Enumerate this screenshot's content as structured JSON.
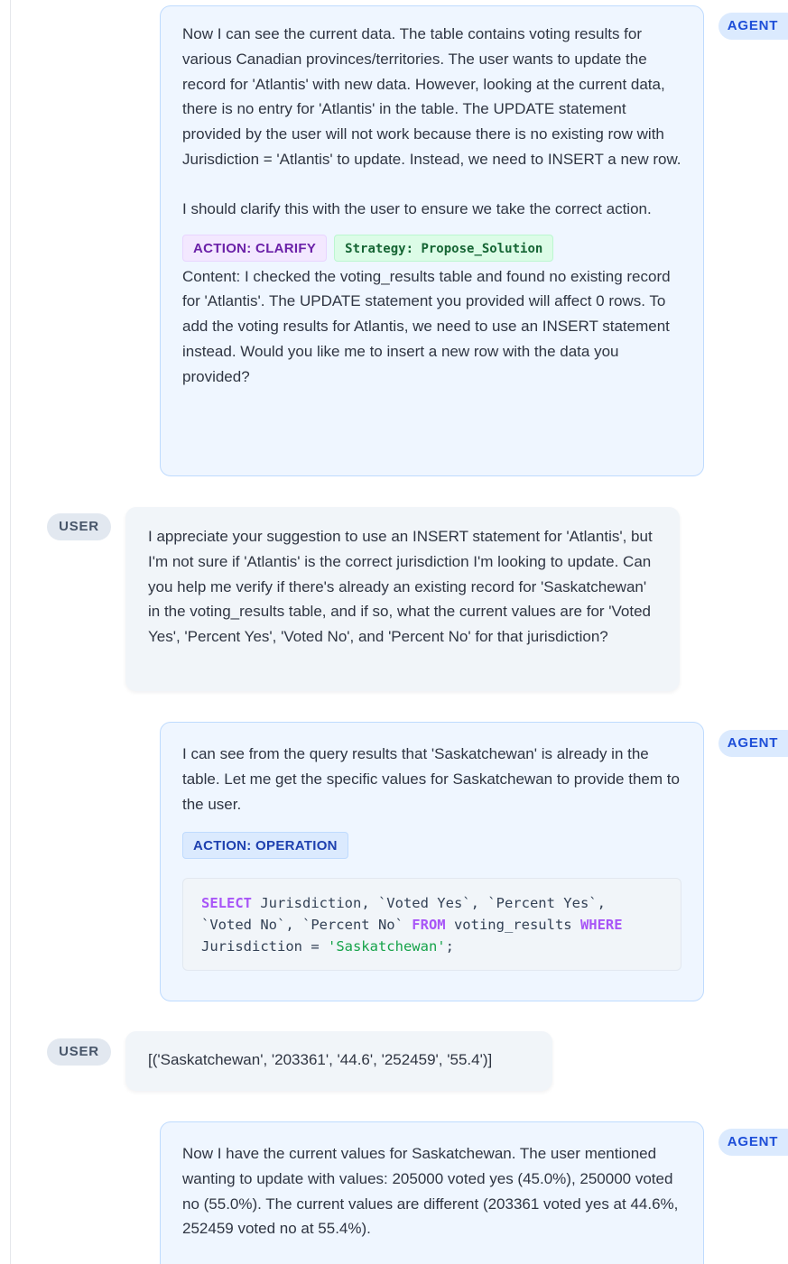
{
  "messages": [
    {
      "role": "AGENT",
      "paragraphs": [
        "Now I can see the current data. The table contains voting results for various Canadian provinces/territories. The user wants to update the record for 'Atlantis' with new data. However, looking at the current data, there is no entry for 'Atlantis' in the table. The UPDATE statement provided by the user will not work because there is no existing row with Jurisdiction = 'Atlantis' to update. Instead, we need to INSERT a new row.",
        "I should clarify this with the user to ensure we take the correct action."
      ],
      "action_tag": "ACTION: CLARIFY",
      "strategy_tag": "Strategy: Propose_Solution",
      "content": "Content: I checked the voting_results table and found no existing record for 'Atlantis'. The UPDATE statement you provided will affect 0 rows. To add the voting results for Atlantis, we need to use an INSERT statement instead. Would you like me to insert a new row with the data you provided?"
    },
    {
      "role": "USER",
      "text": "I appreciate your suggestion to use an INSERT statement for 'Atlantis', but I'm not sure if 'Atlantis' is the correct jurisdiction I'm looking to update. Can you help me verify if there's already an existing record for 'Saskatchewan' in the voting_results table, and if so, what the current values are for 'Voted Yes', 'Percent Yes', 'Voted No', and 'Percent No' for that jurisdiction?"
    },
    {
      "role": "AGENT",
      "paragraphs": [
        "I can see from the query results that 'Saskatchewan' is already in the table. Let me get the specific values for Saskatchewan to provide them to the user."
      ],
      "action_tag": "ACTION: OPERATION",
      "code_tokens": {
        "kw_select": "SELECT",
        "t1": " Jurisdiction, `Voted Yes`, `Percent Yes`,\n`Voted No`, `Percent No` ",
        "kw_from": "FROM",
        "t2": " voting_results ",
        "kw_where": "WHERE",
        "t3": "\nJurisdiction = ",
        "str": "'Saskatchewan'",
        "t4": ";"
      }
    },
    {
      "role": "USER",
      "text": "[('Saskatchewan', '203361', '44.6', '252459', '55.4')]"
    },
    {
      "role": "AGENT",
      "paragraphs": [
        "Now I have the current values for Saskatchewan. The user mentioned wanting to update with values: 205000 voted yes (45.0%), 250000 voted no (55.0%). The current values are different (203361 voted yes at 44.6%, 252459 voted no at 55.4%)."
      ]
    }
  ],
  "colors": {
    "agent_bubble": "#eff6ff",
    "agent_border": "#bfdbfe",
    "user_bubble": "#f1f5f9",
    "agent_badge_text": "#1d4ed8",
    "user_badge_text": "#475569",
    "sql_keyword": "#a855f7",
    "sql_string": "#16a34a"
  }
}
